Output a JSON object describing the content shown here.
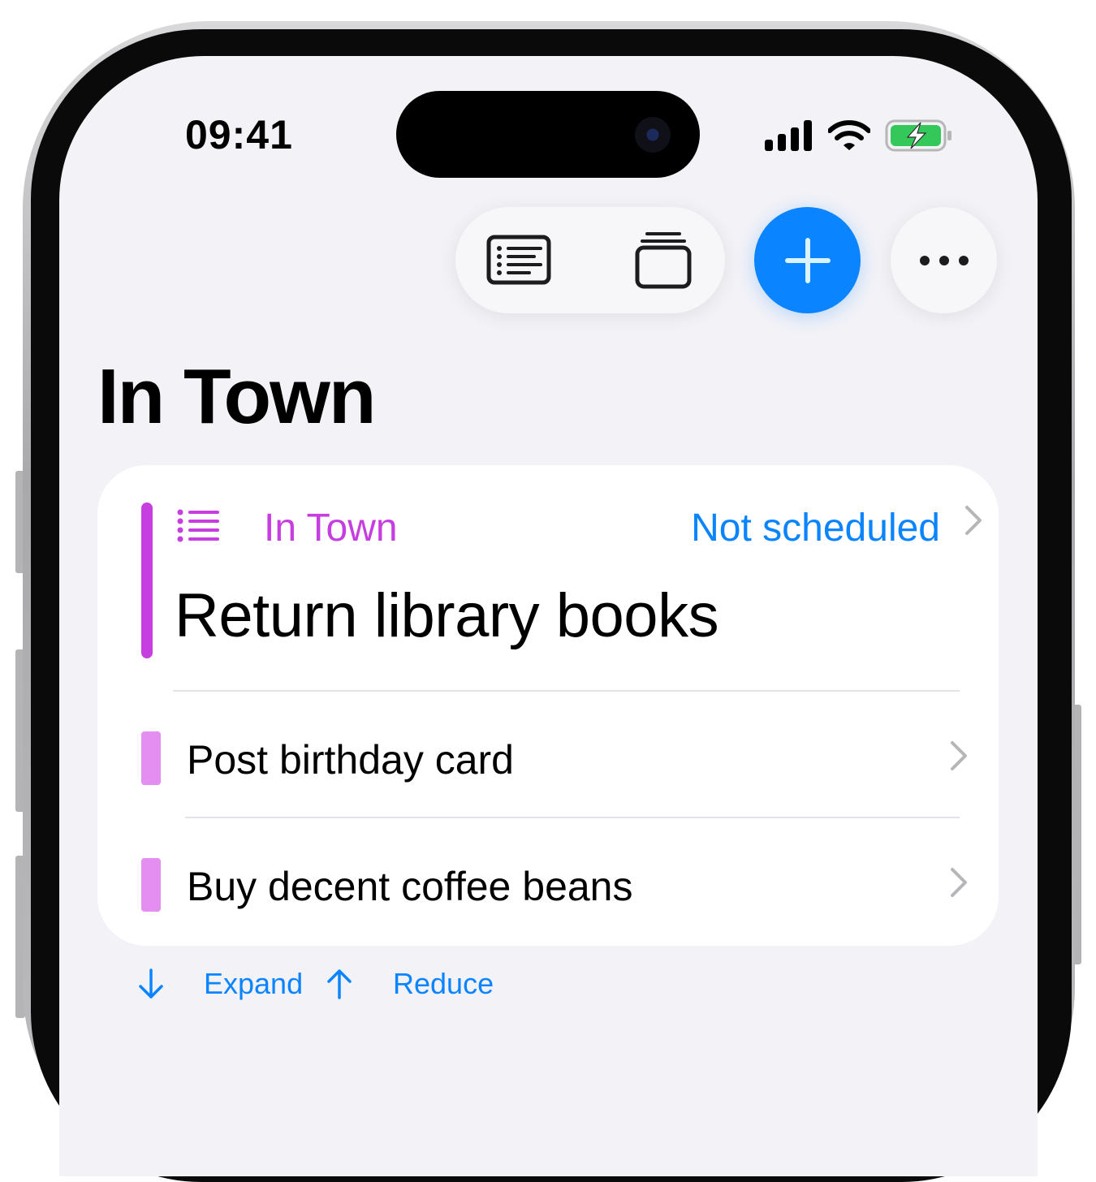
{
  "status_bar": {
    "time": "09:41",
    "icons": [
      "cellular-signal-icon",
      "wifi-icon",
      "battery-charging-icon"
    ]
  },
  "toolbar": {
    "buttons": [
      "list-view-icon",
      "stack-view-icon",
      "plus-icon",
      "more-icon"
    ]
  },
  "page": {
    "title": "In Town"
  },
  "card": {
    "list_name": "In Town",
    "schedule": "Not scheduled",
    "main_task": "Return library books",
    "items": [
      {
        "label": "Post birthday card"
      },
      {
        "label": "Buy decent coffee beans"
      }
    ]
  },
  "footer": {
    "expand_label": "Expand",
    "reduce_label": "Reduce"
  },
  "colors": {
    "accent": "#0a84ff",
    "list_color": "#c73ee0",
    "list_color_light": "#e38ef0",
    "background": "#f2f2f7"
  }
}
